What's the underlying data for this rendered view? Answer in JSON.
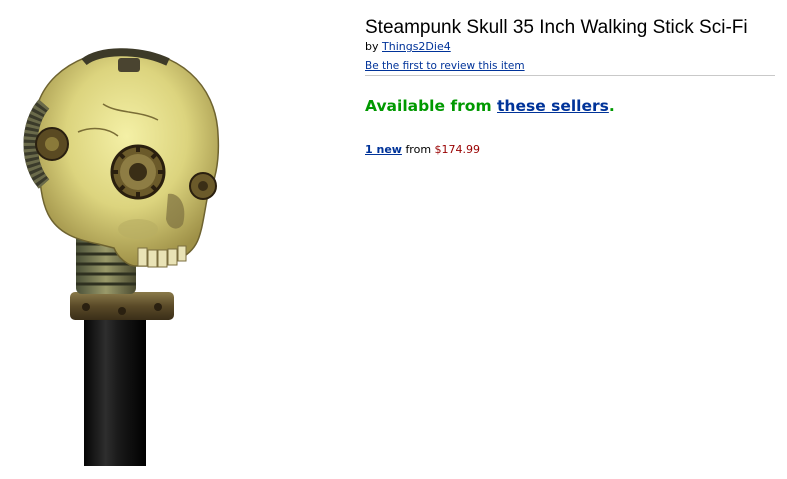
{
  "product": {
    "title": "Steampunk Skull 35 Inch Walking Stick Sci-Fi",
    "by_prefix": "by",
    "brand": "Things2Die4",
    "review_prompt": "Be the first to review this item",
    "image_alt": "Steampunk skull walking stick handle"
  },
  "availability": {
    "prefix": "Available from",
    "link_text": "these sellers",
    "suffix": "."
  },
  "offers": {
    "link_text": "1 new",
    "from_text": "from",
    "price": "$174.99"
  },
  "colors": {
    "link": "#003399",
    "availability_green": "#009900",
    "price": "#990000",
    "divider": "#c9c9c9"
  }
}
